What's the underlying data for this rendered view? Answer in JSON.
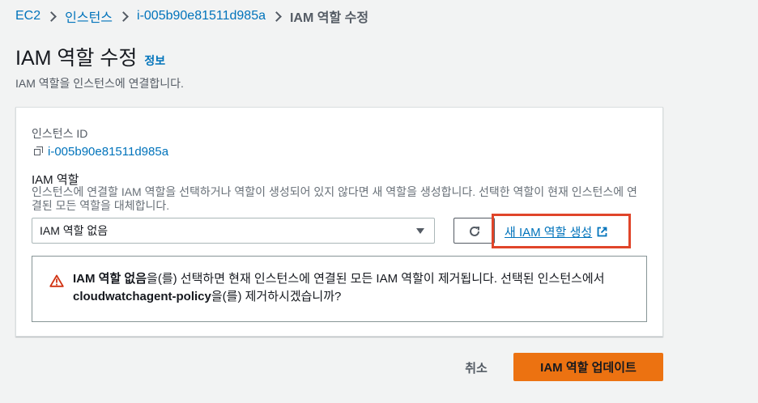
{
  "breadcrumb": {
    "items": [
      "EC2",
      "인스턴스",
      "i-005b90e81511d985a"
    ],
    "current": "IAM 역할 수정"
  },
  "header": {
    "title": "IAM 역할 수정",
    "info_link": "정보",
    "description": "IAM 역할을 인스턴스에 연결합니다."
  },
  "form": {
    "instance_id_label": "인스턴스 ID",
    "instance_id_value": "i-005b90e81511d985a",
    "role_label": "IAM 역할",
    "role_description": "인스턴스에 연결할 IAM 역할을 선택하거나 역할이 생성되어 있지 않다면 새 역할을 생성합니다. 선택한 역할이 현재 인스턴스에 연결된 모든 역할을 대체합니다.",
    "role_select_value": "IAM 역할 없음",
    "create_role_link": "새 IAM 역할 생성"
  },
  "warning": {
    "bold_1": "IAM 역할 없음",
    "text_1": "을(를) 선택하면 현재 인스턴스에 연결된 모든 IAM 역할이 제거됩니다. 선택된 인스턴스에서 ",
    "bold_2": "cloudwatchagent-policy",
    "text_2": "을(를) 제거하시겠습니까?"
  },
  "actions": {
    "cancel_label": "취소",
    "update_label": "IAM 역할 업데이트"
  },
  "colors": {
    "link": "#0073bb",
    "primary_button": "#ec7211",
    "highlight": "#e0452a",
    "warning_icon": "#d13212"
  }
}
